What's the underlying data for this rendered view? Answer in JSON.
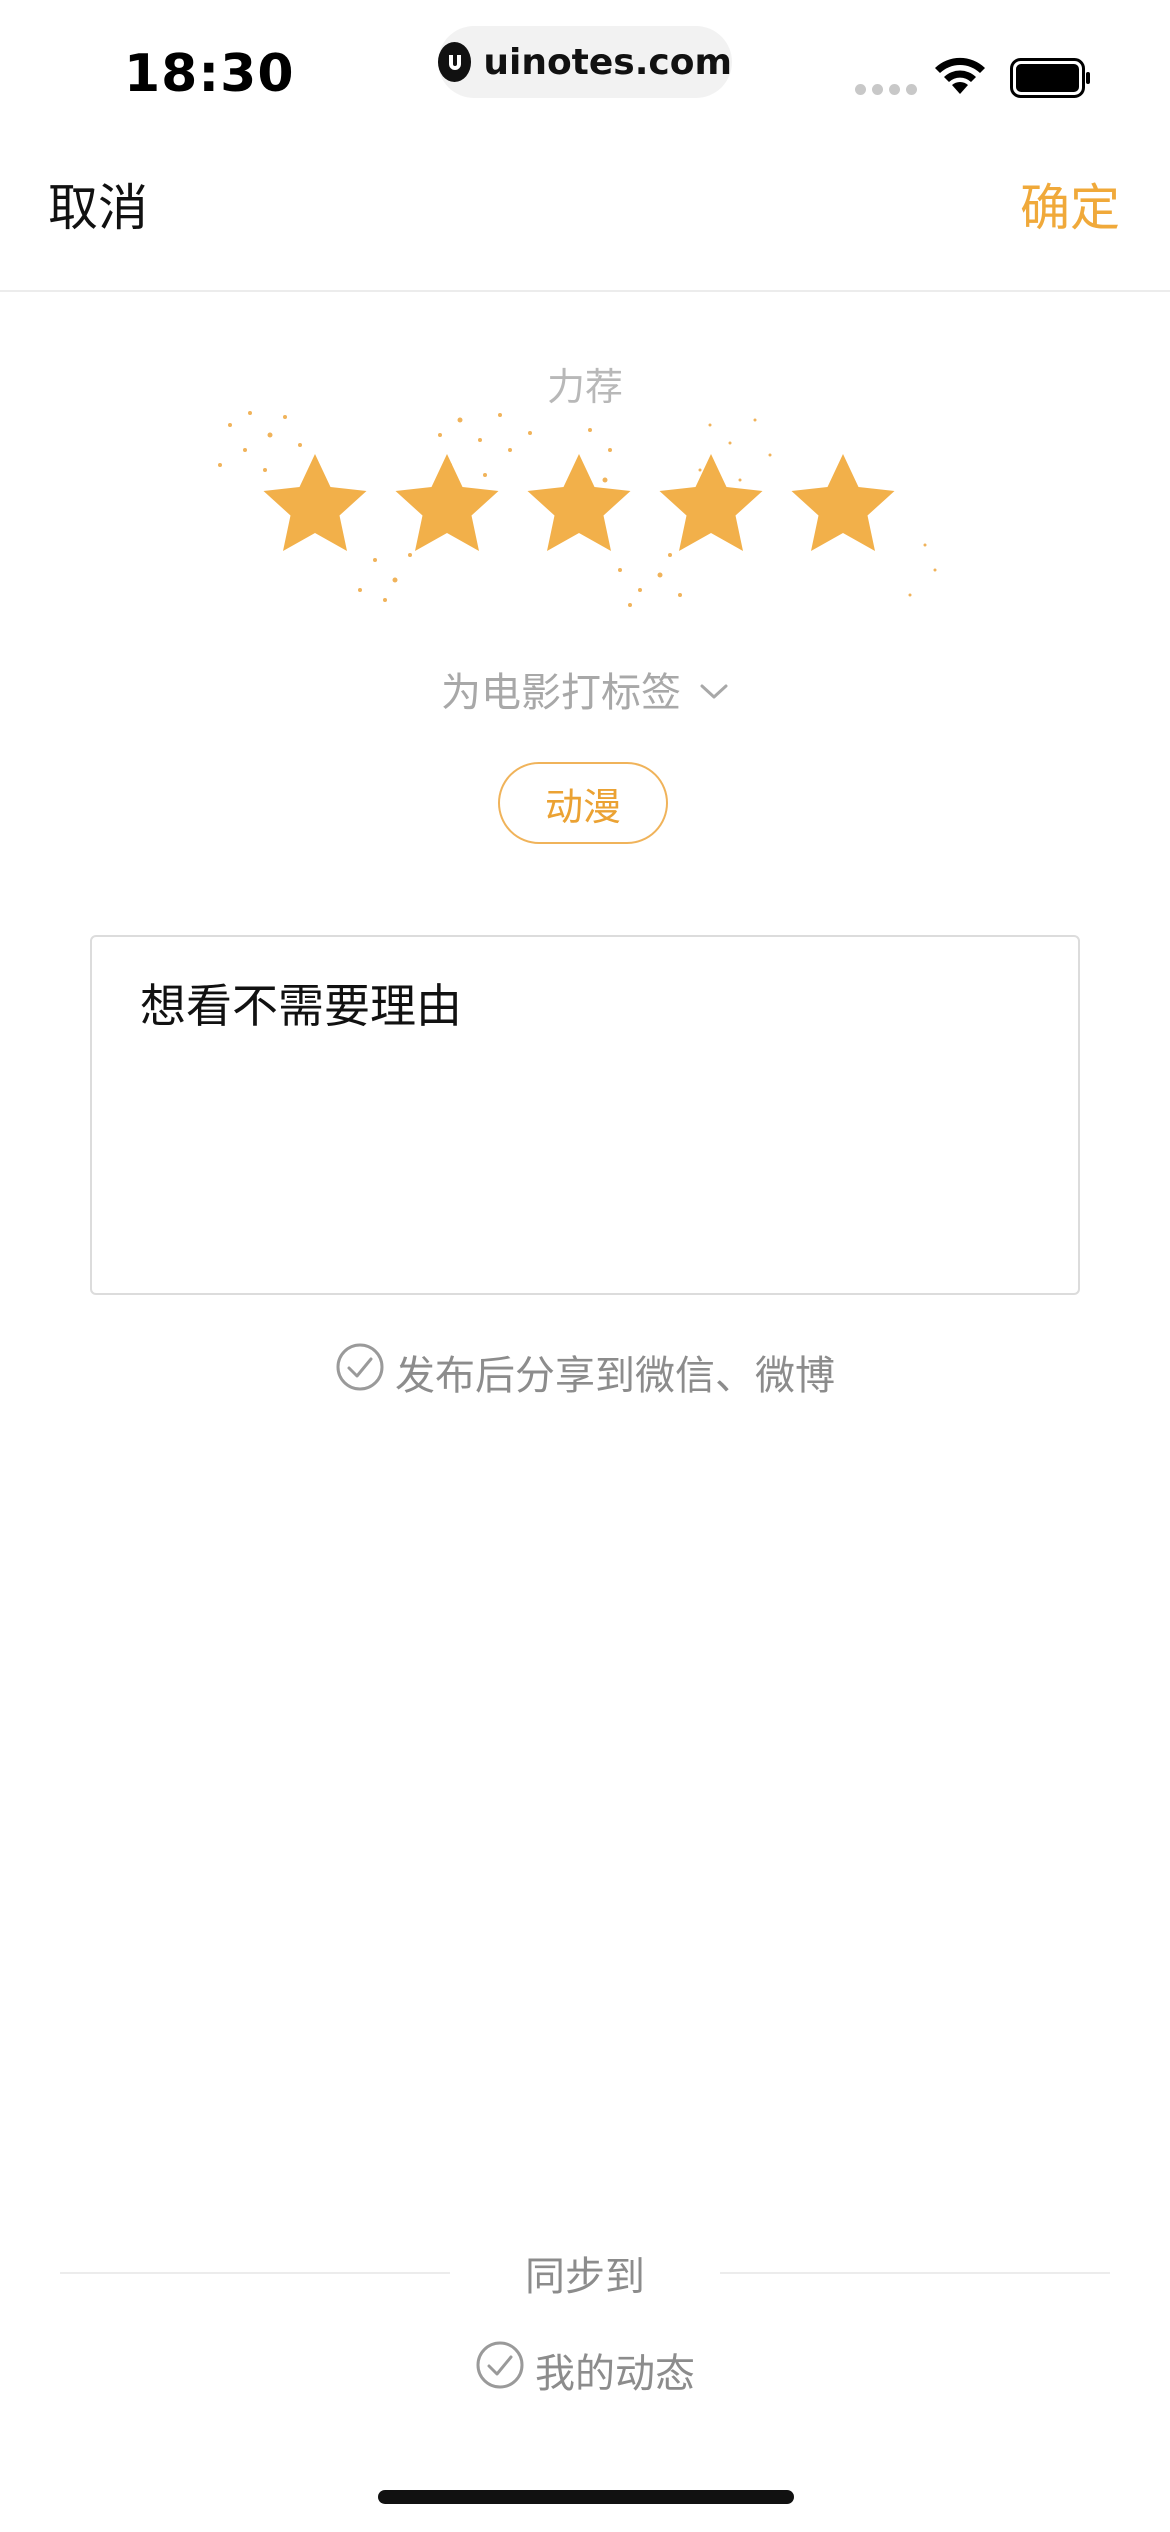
{
  "status_bar": {
    "time": "18:30",
    "url": "uinotes.com",
    "icons": [
      "signal-icon",
      "wifi-icon",
      "battery-icon"
    ]
  },
  "nav": {
    "cancel_label": "取消",
    "confirm_label": "确定"
  },
  "rating": {
    "label": "力荐",
    "value": 5,
    "max": 5,
    "star_color": "#f2b04a"
  },
  "tags": {
    "prompt": "为电影打标签",
    "items": [
      "动漫"
    ]
  },
  "comment": {
    "value": "想看不需要理由"
  },
  "share": {
    "label": "发布后分享到微信、微博",
    "checked": false
  },
  "sync": {
    "title": "同步到",
    "option_label": "我的动态",
    "checked": false
  },
  "colors": {
    "accent": "#f0a93a",
    "muted_text": "#8c8c8c"
  }
}
